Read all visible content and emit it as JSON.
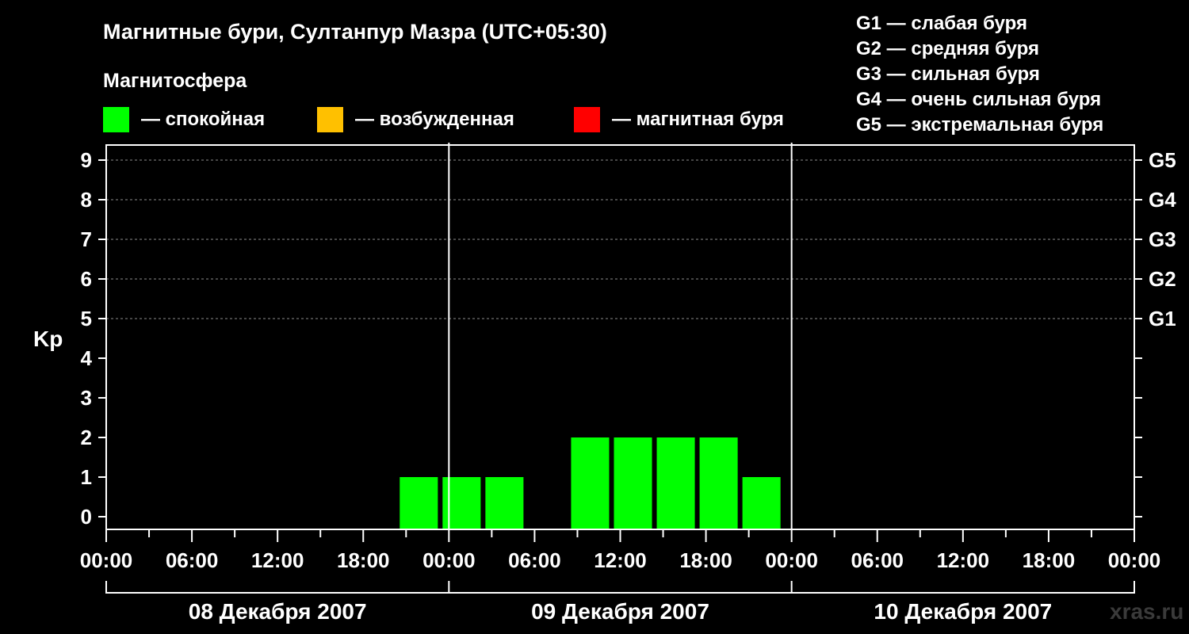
{
  "title": "Магнитные бури, Султанпур Мазра (UTC+05:30)",
  "subtitle": "Магнитосфера",
  "status_legend": [
    {
      "color": "#00ff00",
      "label": "— спокойная"
    },
    {
      "color": "#ffc000",
      "label": "— возбужденная"
    },
    {
      "color": "#ff0000",
      "label": "— магнитная буря"
    }
  ],
  "g_legend": [
    "G1 — слабая буря",
    "G2 — средняя буря",
    "G3 — сильная буря",
    "G4 — очень сильная буря",
    "G5 — экстремальная буря"
  ],
  "watermark": "xras.ru",
  "chart_data": {
    "type": "bar",
    "ylabel": "Kp",
    "ylim": [
      0,
      9
    ],
    "yticks": [
      "0",
      "1",
      "2",
      "3",
      "4",
      "5",
      "6",
      "7",
      "8",
      "9"
    ],
    "g_scale": [
      {
        "kp": 5,
        "label": "G1"
      },
      {
        "kp": 6,
        "label": "G2"
      },
      {
        "kp": 7,
        "label": "G3"
      },
      {
        "kp": 8,
        "label": "G4"
      },
      {
        "kp": 9,
        "label": "G5"
      }
    ],
    "grid": "dashed horizontal at Kp 5–9",
    "xlim_hours": [
      0,
      72
    ],
    "x_tick_labels": [
      "00:00",
      "06:00",
      "12:00",
      "18:00",
      "00:00",
      "06:00",
      "12:00",
      "18:00",
      "00:00",
      "06:00",
      "12:00",
      "18:00",
      "00:00"
    ],
    "days": [
      "08 Декабря 2007",
      "09 Декабря 2007",
      "10 Декабря 2007"
    ],
    "colors": {
      "quiet": "#00ff00",
      "active": "#ffc000",
      "storm": "#ff0000"
    },
    "bars": [
      {
        "start_hour": 20.5,
        "kp": 1
      },
      {
        "start_hour": 23.5,
        "kp": 1
      },
      {
        "start_hour": 26.5,
        "kp": 1
      },
      {
        "start_hour": 32.5,
        "kp": 2
      },
      {
        "start_hour": 35.5,
        "kp": 2
      },
      {
        "start_hour": 38.5,
        "kp": 2
      },
      {
        "start_hour": 41.5,
        "kp": 2
      },
      {
        "start_hour": 44.5,
        "kp": 1
      }
    ]
  }
}
